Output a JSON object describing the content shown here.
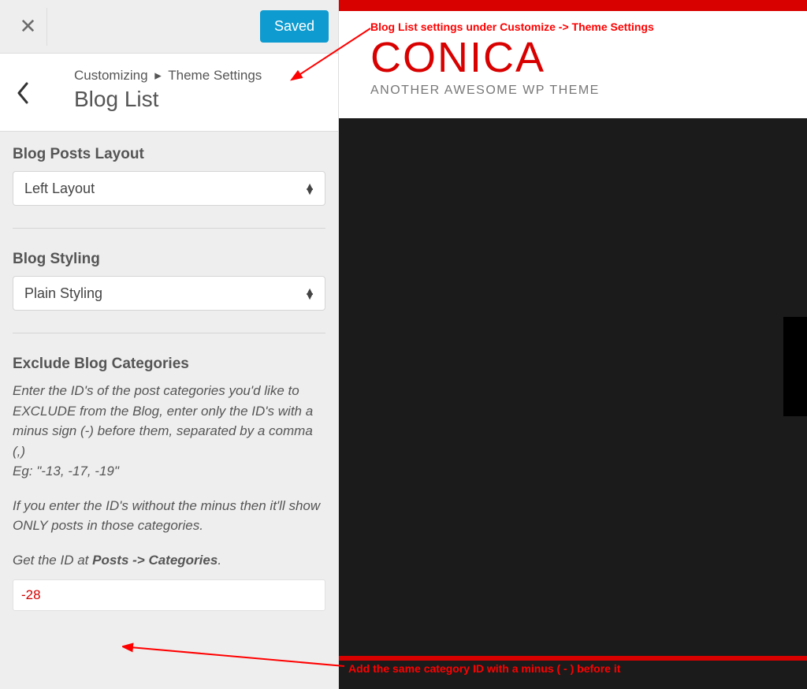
{
  "topbar": {
    "saved_label": "Saved"
  },
  "breadcrumb": {
    "root": "Customizing",
    "parent": "Theme Settings",
    "title": "Blog List"
  },
  "section_layout": {
    "label": "Blog Posts Layout",
    "value": "Left Layout"
  },
  "section_styling": {
    "label": "Blog Styling",
    "value": "Plain Styling"
  },
  "section_exclude": {
    "label": "Exclude Blog Categories",
    "desc_l1": "Enter the ID's of the post categories you'd like to EXCLUDE from the Blog, enter only the ID's with a minus sign (-) before them, separated by a comma (,)",
    "desc_l2": "Eg: \"-13, -17, -19\"",
    "desc_l3": "If you enter the ID's without the minus then it'll show ONLY posts in those categories.",
    "desc_l4_pre": "Get the ID at ",
    "desc_l4_bold": "Posts -> Categories",
    "desc_l4_post": ".",
    "value": "-28"
  },
  "preview": {
    "logo": "CONICA",
    "tagline": "ANOTHER AWESOME WP THEME"
  },
  "annotations": {
    "top": "Blog List settings under Customize -> Theme Settings",
    "bottom": "Add the same category ID with a minus ( - ) before it"
  }
}
